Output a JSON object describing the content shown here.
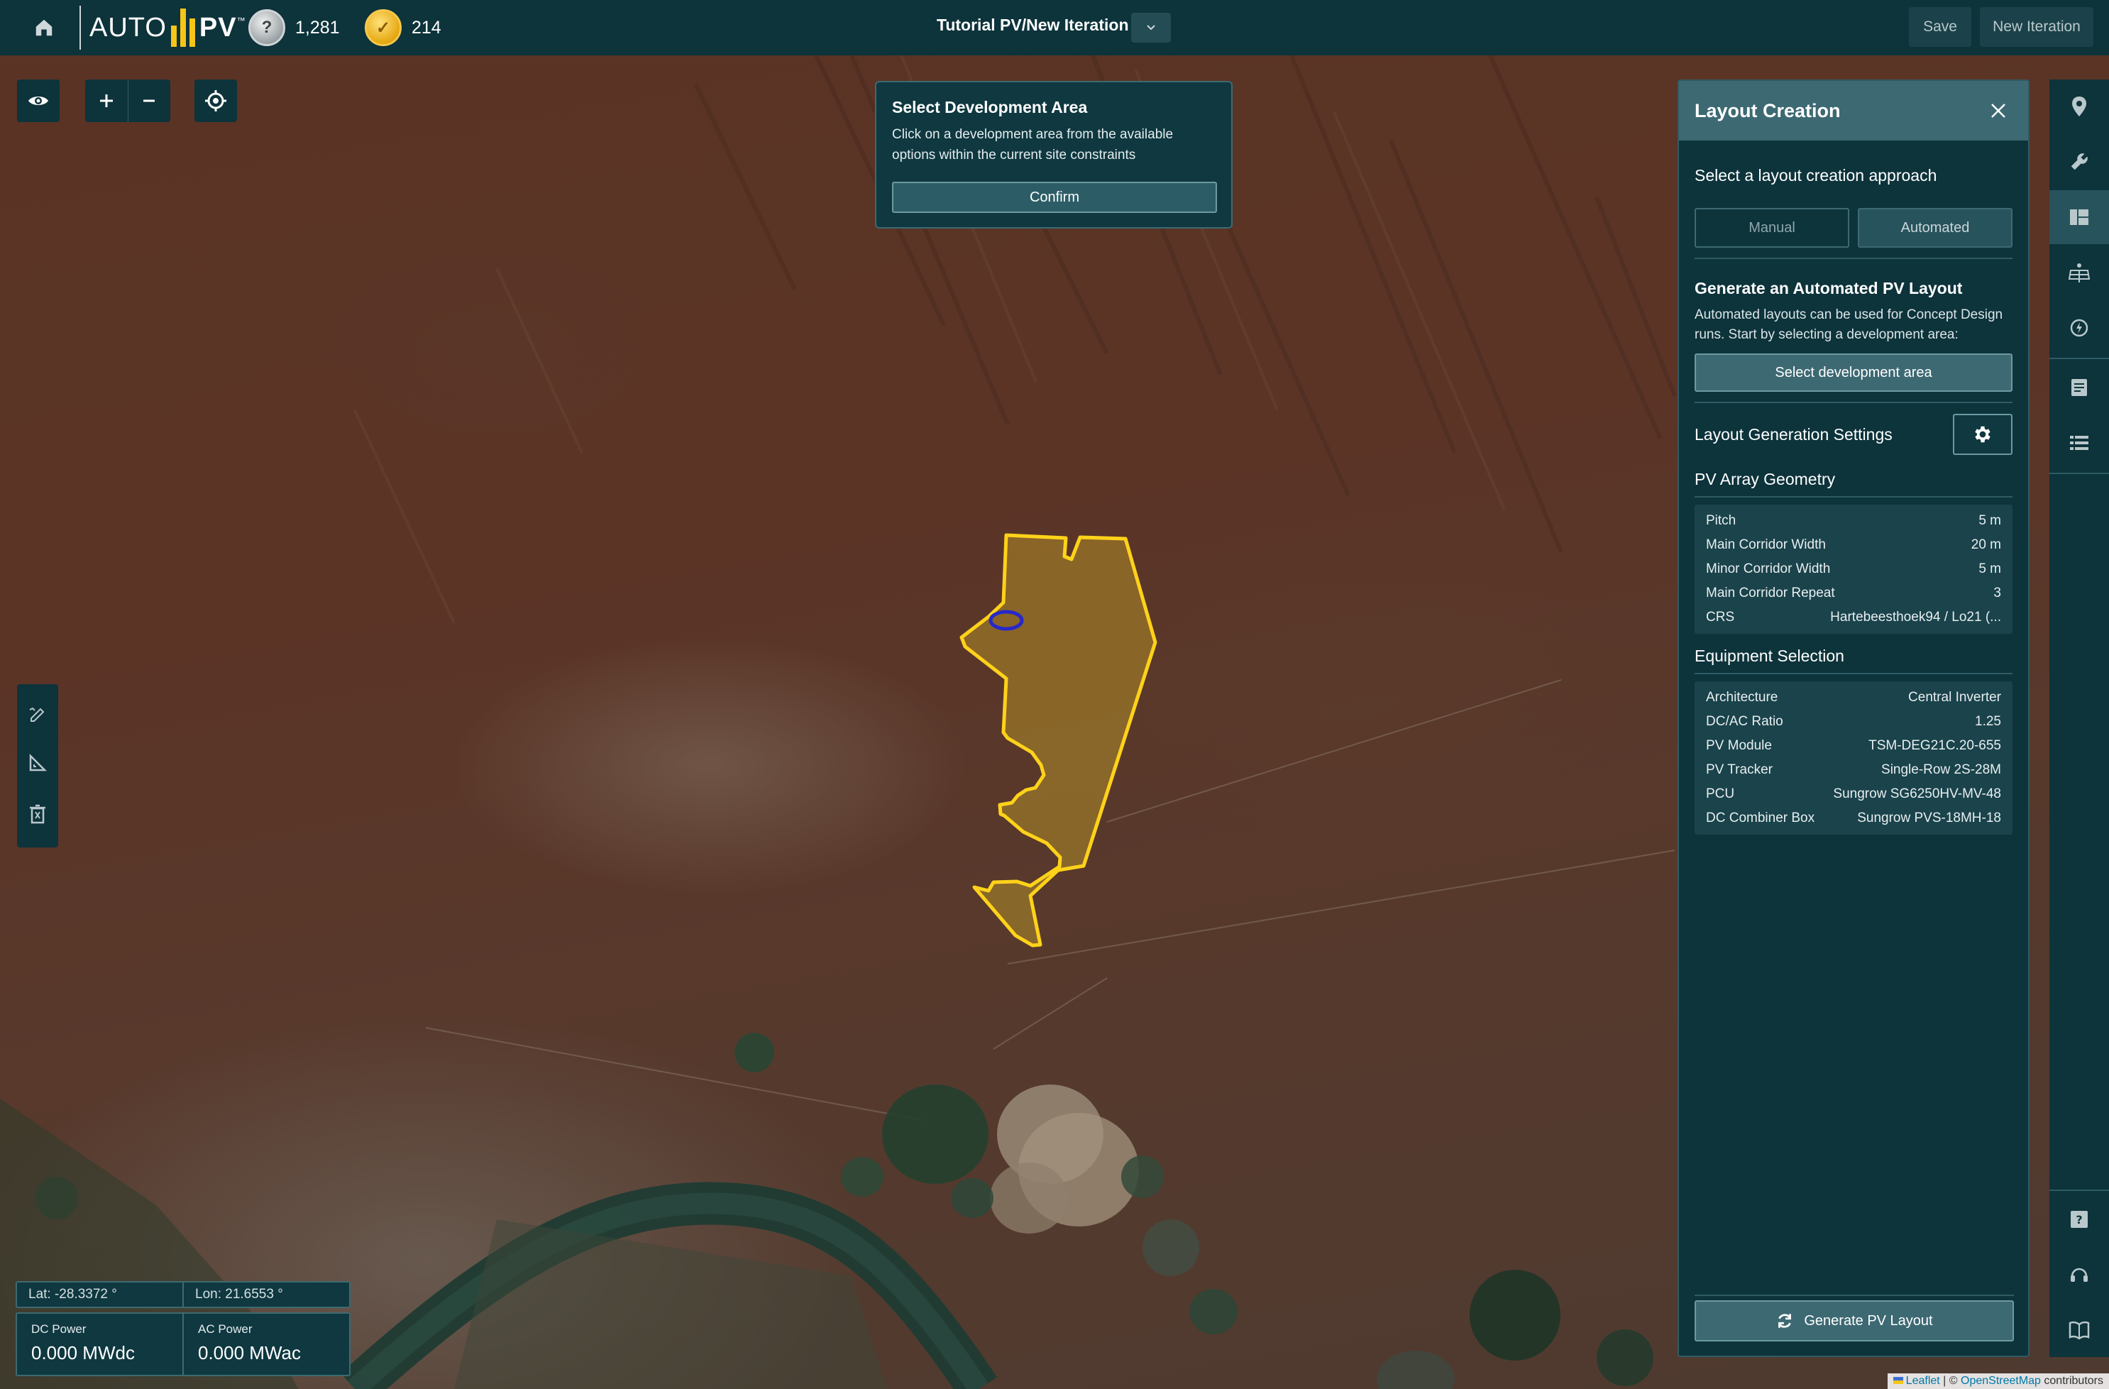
{
  "topbar": {
    "logo_auto": "AUTO",
    "logo_pv": "PV",
    "logo_tm": "™",
    "credits_silver": "1,281",
    "credits_gold": "214",
    "project_title": "Tutorial PV/New Iteration",
    "save_label": "Save",
    "new_iteration_label": "New Iteration"
  },
  "popup": {
    "title": "Select Development Area",
    "text": "Click on a development area from the available options within the current site constraints",
    "confirm_label": "Confirm"
  },
  "coords": {
    "lat": "Lat: -28.3372 °",
    "lon": "Lon: 21.6553 °"
  },
  "power": {
    "dc_label": "DC Power",
    "dc_value": "0.000 MWdc",
    "ac_label": "AC Power",
    "ac_value": "0.000 MWac"
  },
  "attribution": {
    "leaflet": "Leaflet",
    "sep": " | © ",
    "osm": "OpenStreetMap",
    "tail": " contributors"
  },
  "panel": {
    "title": "Layout Creation",
    "approach_title": "Select a layout creation approach",
    "manual_label": "Manual",
    "automated_label": "Automated",
    "gen_title": "Generate an Automated PV Layout",
    "gen_desc": "Automated layouts can be used for Concept Design runs. Start by selecting a development area:",
    "select_area_label": "Select development area",
    "settings_title": "Layout Generation Settings",
    "geometry_title": "PV Array Geometry",
    "geometry": [
      {
        "key": "Pitch",
        "value": "5 m"
      },
      {
        "key": "Main Corridor Width",
        "value": "20 m"
      },
      {
        "key": "Minor Corridor Width",
        "value": "5 m"
      },
      {
        "key": "Main Corridor Repeat",
        "value": "3"
      },
      {
        "key": "CRS",
        "value": "Hartebeesthoek94 / Lo21 (..."
      }
    ],
    "equipment_title": "Equipment Selection",
    "equipment": [
      {
        "key": "Architecture",
        "value": "Central Inverter"
      },
      {
        "key": "DC/AC Ratio",
        "value": "1.25"
      },
      {
        "key": "PV Module",
        "value": "TSM-DEG21C.20-655"
      },
      {
        "key": "PV Tracker",
        "value": "Single-Row 2S-28M"
      },
      {
        "key": "PCU",
        "value": "Sungrow SG6250HV-MV-48"
      },
      {
        "key": "DC Combiner Box",
        "value": "Sungrow PVS-18MH-18"
      }
    ],
    "generate_label": "Generate PV Layout"
  },
  "icons": {
    "home": "home-icon",
    "visibility": "eye-icon",
    "locate": "crosshair-icon",
    "draw": "edit-pen-icon",
    "measure": "ruler-triangle-icon",
    "delete": "trash-icon",
    "gear": "gear-icon",
    "refresh": "refresh-icon",
    "close": "close-icon"
  },
  "colors": {
    "bar": "#0d333b",
    "accent_yellow": "#f5c518",
    "polygon_stroke": "#ffd21a",
    "exclusion_stroke": "#2828c8"
  }
}
